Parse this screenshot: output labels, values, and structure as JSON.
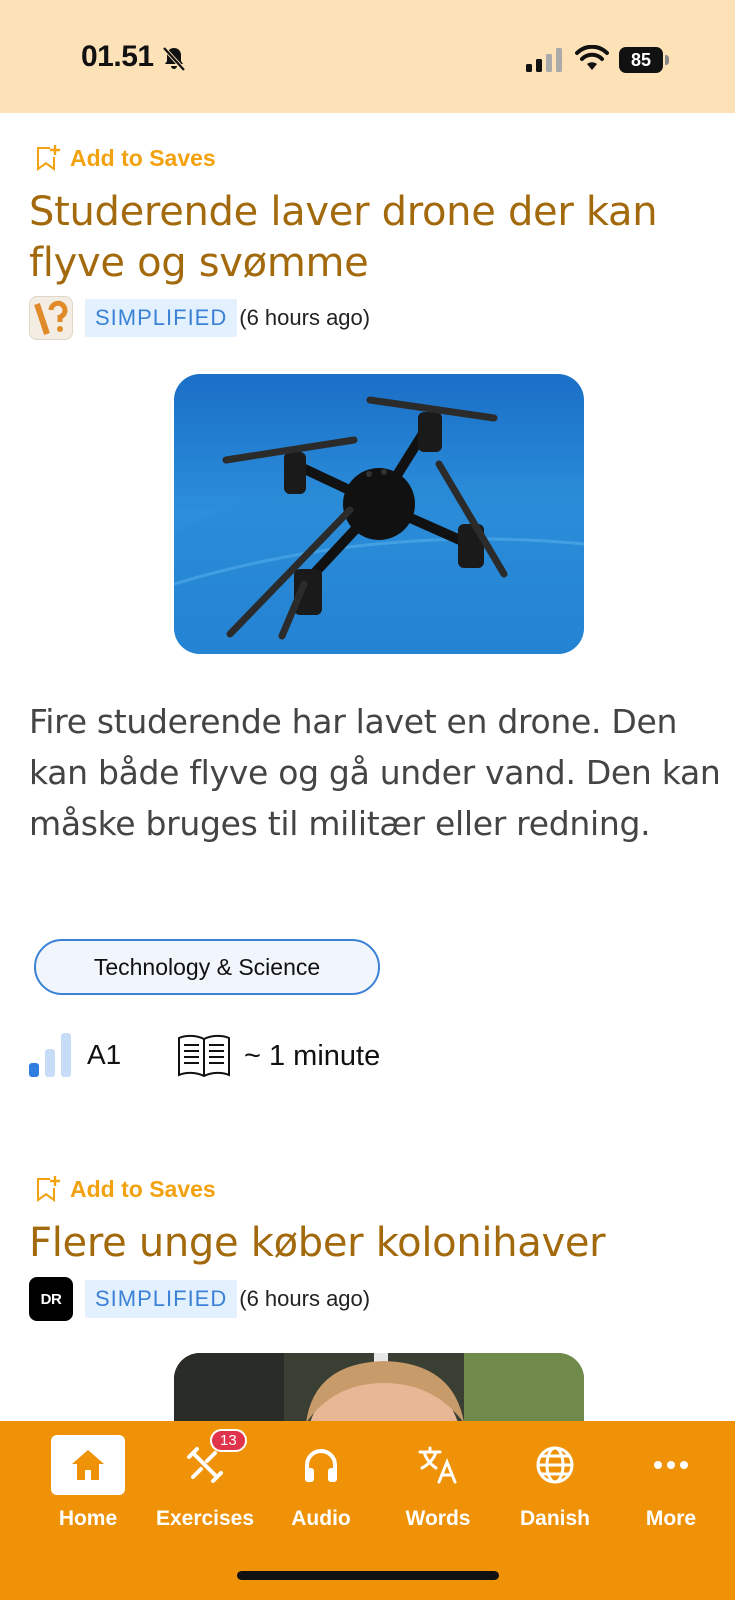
{
  "status_bar": {
    "time": "01.51",
    "battery": "85"
  },
  "articles": [
    {
      "save_label": "Add to Saves",
      "title": "Studerende laver drone der kan flyve og svømme",
      "badge": "SIMPLIFIED",
      "time_ago": "(6 hours ago)",
      "summary": "Fire studerende har lavet en drone. Den kan både flyve og gå under vand. Den kan måske bruges til militær eller redning.",
      "topic": "Technology & Science",
      "level": "A1",
      "level_bars": 1,
      "read_time": "~ 1 minute"
    },
    {
      "save_label": "Add to Saves",
      "title": "Flere unge køber kolonihaver",
      "source_logo_text": "DR",
      "badge": "SIMPLIFIED",
      "time_ago": "(6 hours ago)"
    }
  ],
  "nav": {
    "items": [
      {
        "label": "Home",
        "icon": "home-icon",
        "active": true
      },
      {
        "label": "Exercises",
        "icon": "exercises-icon",
        "badge": "13"
      },
      {
        "label": "Audio",
        "icon": "headphones-icon"
      },
      {
        "label": "Words",
        "icon": "translate-icon"
      },
      {
        "label": "Danish",
        "icon": "globe-icon"
      },
      {
        "label": "More",
        "icon": "more-icon"
      }
    ]
  },
  "colors": {
    "status_bar_bg": "#fde2b8",
    "title": "#a36a0d",
    "save_accent": "#f2a20f",
    "badge_text": "#3b82d6",
    "nav_bg": "#ef9208"
  }
}
